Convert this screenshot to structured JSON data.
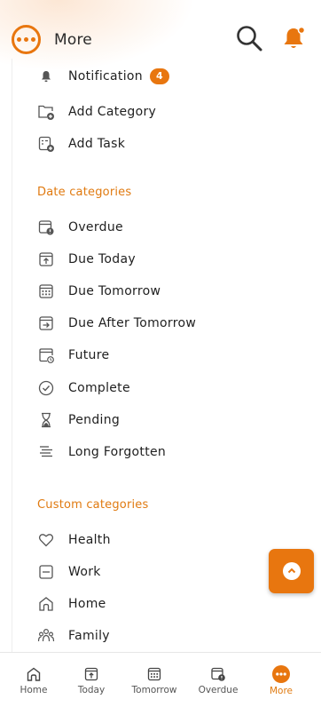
{
  "header": {
    "title": "More"
  },
  "top_items": [
    {
      "label": "Notification",
      "badge": "4"
    },
    {
      "label": "Add Category"
    },
    {
      "label": "Add Task"
    }
  ],
  "date_section": {
    "title": "Date categories",
    "items": [
      {
        "label": "Overdue"
      },
      {
        "label": "Due Today"
      },
      {
        "label": "Due Tomorrow"
      },
      {
        "label": "Due After Tomorrow"
      },
      {
        "label": "Future"
      },
      {
        "label": "Complete"
      },
      {
        "label": "Pending"
      },
      {
        "label": "Long Forgotten"
      }
    ]
  },
  "custom_section": {
    "title": "Custom categories",
    "items": [
      {
        "label": "Health"
      },
      {
        "label": "Work"
      },
      {
        "label": "Home"
      },
      {
        "label": "Family"
      }
    ]
  },
  "bottom_nav": [
    {
      "label": "Home"
    },
    {
      "label": "Today"
    },
    {
      "label": "Tomorrow"
    },
    {
      "label": "Overdue"
    },
    {
      "label": "More"
    }
  ],
  "colors": {
    "accent": "#e8760f",
    "section_title": "#e07a10"
  }
}
